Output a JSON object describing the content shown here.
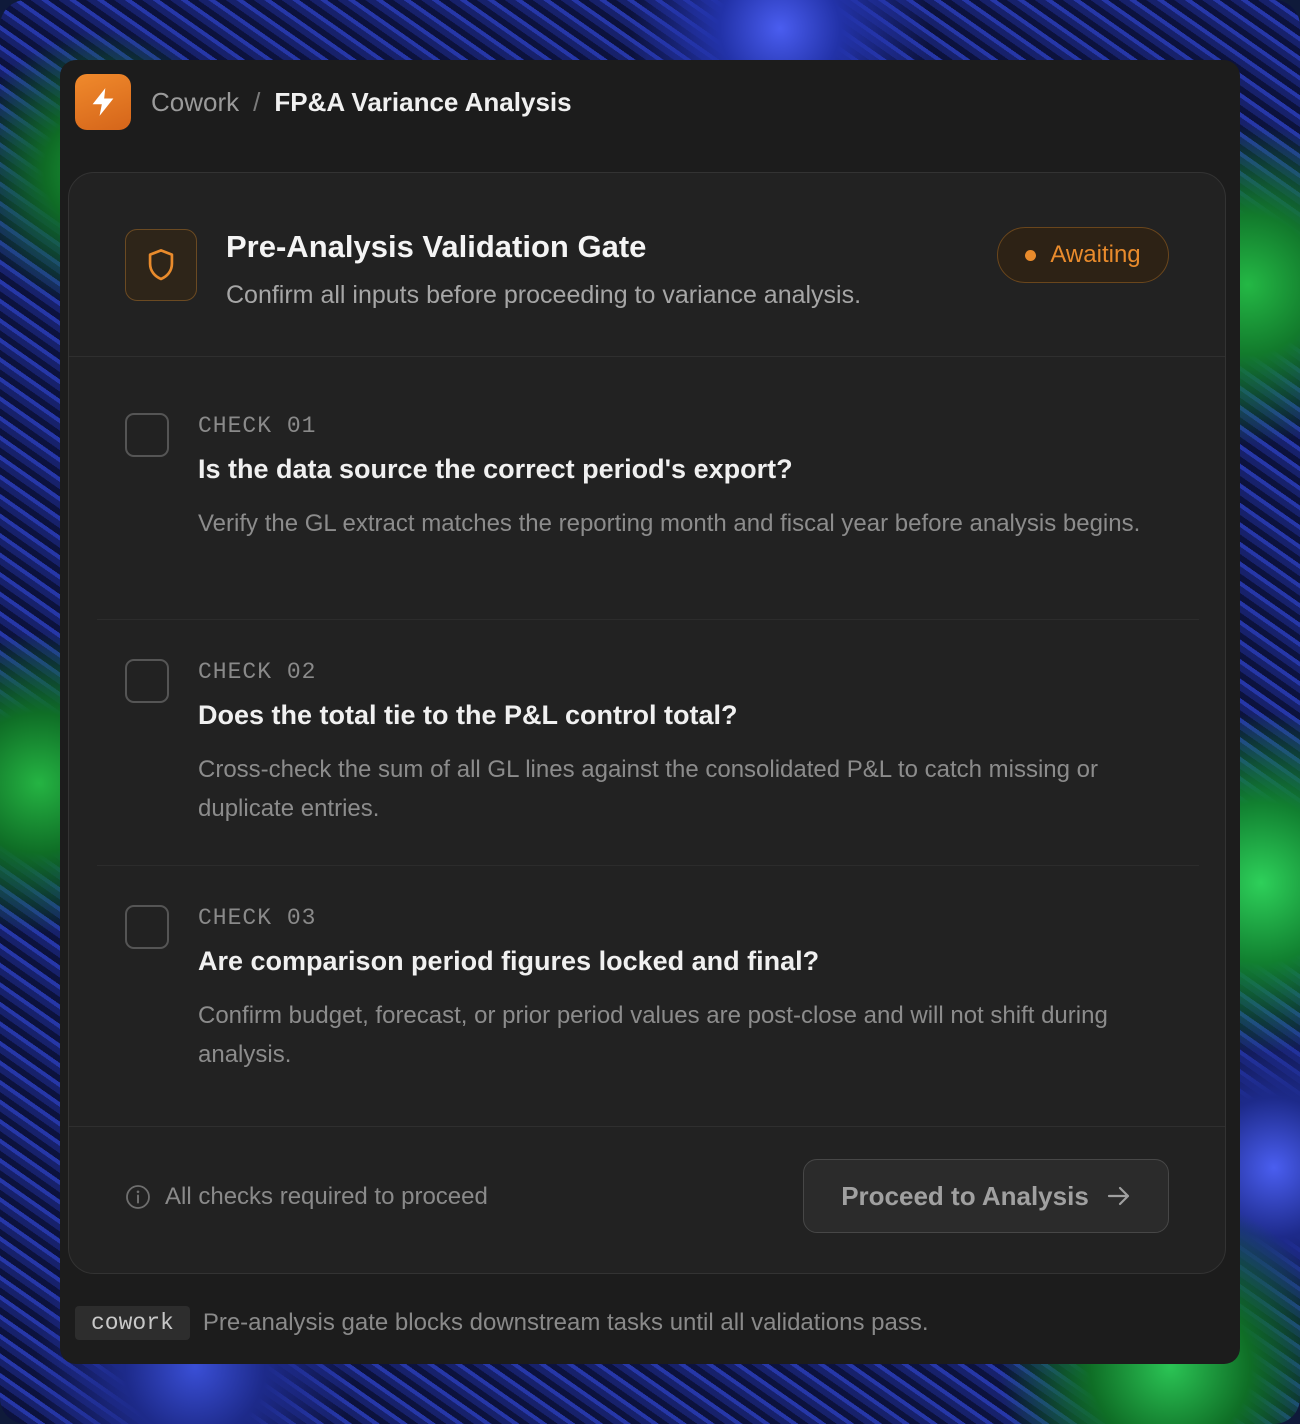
{
  "breadcrumb": {
    "root": "Cowork",
    "separator": "/",
    "current": "FP&A Variance Analysis"
  },
  "gate": {
    "title": "Pre-Analysis Validation Gate",
    "subtitle": "Confirm all inputs before proceeding to variance analysis.",
    "status": "Awaiting",
    "status_color": "#e98b2c"
  },
  "checks": [
    {
      "label": "CHECK 01",
      "question": "Is the data source the correct period's export?",
      "description": "Verify the GL extract matches the reporting month and fiscal year before analysis begins.",
      "checked": false
    },
    {
      "label": "CHECK 02",
      "question": "Does the total tie to the P&L control total?",
      "description": "Cross-check the sum of all GL lines against the consolidated P&L to catch missing or duplicate entries.",
      "checked": false
    },
    {
      "label": "CHECK 03",
      "question": "Are comparison period figures locked and final?",
      "description": "Confirm budget, forecast, or prior period values are post-close and will not shift during analysis.",
      "checked": false
    }
  ],
  "footer": {
    "requirement": "All checks required to proceed",
    "proceed_label": "Proceed to Analysis"
  },
  "bottom": {
    "tag": "cowork",
    "text": "Pre-analysis gate blocks downstream tasks until all validations pass."
  },
  "icons": {
    "app": "lightning-icon",
    "gate": "shield-icon",
    "info": "info-icon",
    "proceed": "arrow-right-icon"
  },
  "colors": {
    "accent": "#e98b2c",
    "background": "#1c1c1c",
    "card": "#222222"
  }
}
